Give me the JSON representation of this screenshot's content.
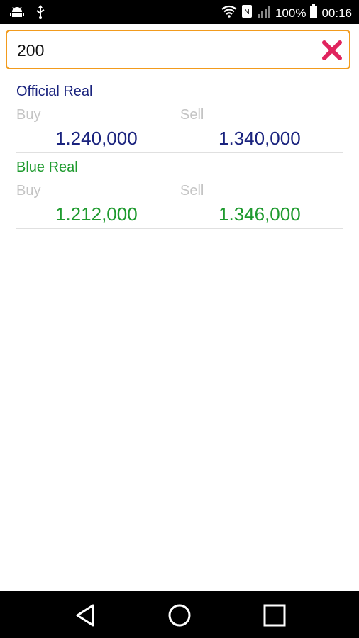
{
  "status_bar": {
    "battery_percent": "100%",
    "time": "00:16",
    "icons": [
      "android-debug-icon",
      "usb-icon",
      "wifi-icon",
      "nfc-icon",
      "signal-icon",
      "battery-icon"
    ]
  },
  "search": {
    "value": "200",
    "clear_icon": "close-icon",
    "clear_color": "#e0245e",
    "border_color": "#f29b1d"
  },
  "rates": [
    {
      "title": "Official Real",
      "buy_label": "Buy",
      "sell_label": "Sell",
      "buy_value": "1.240,000",
      "sell_value": "1.340,000",
      "color": "#1a237e"
    },
    {
      "title": "Blue Real",
      "buy_label": "Buy",
      "sell_label": "Sell",
      "buy_value": "1.212,000",
      "sell_value": "1.346,000",
      "color": "#1e9a2e"
    }
  ],
  "nav_bar": {
    "icons": [
      "back-icon",
      "home-icon",
      "recents-icon"
    ]
  }
}
